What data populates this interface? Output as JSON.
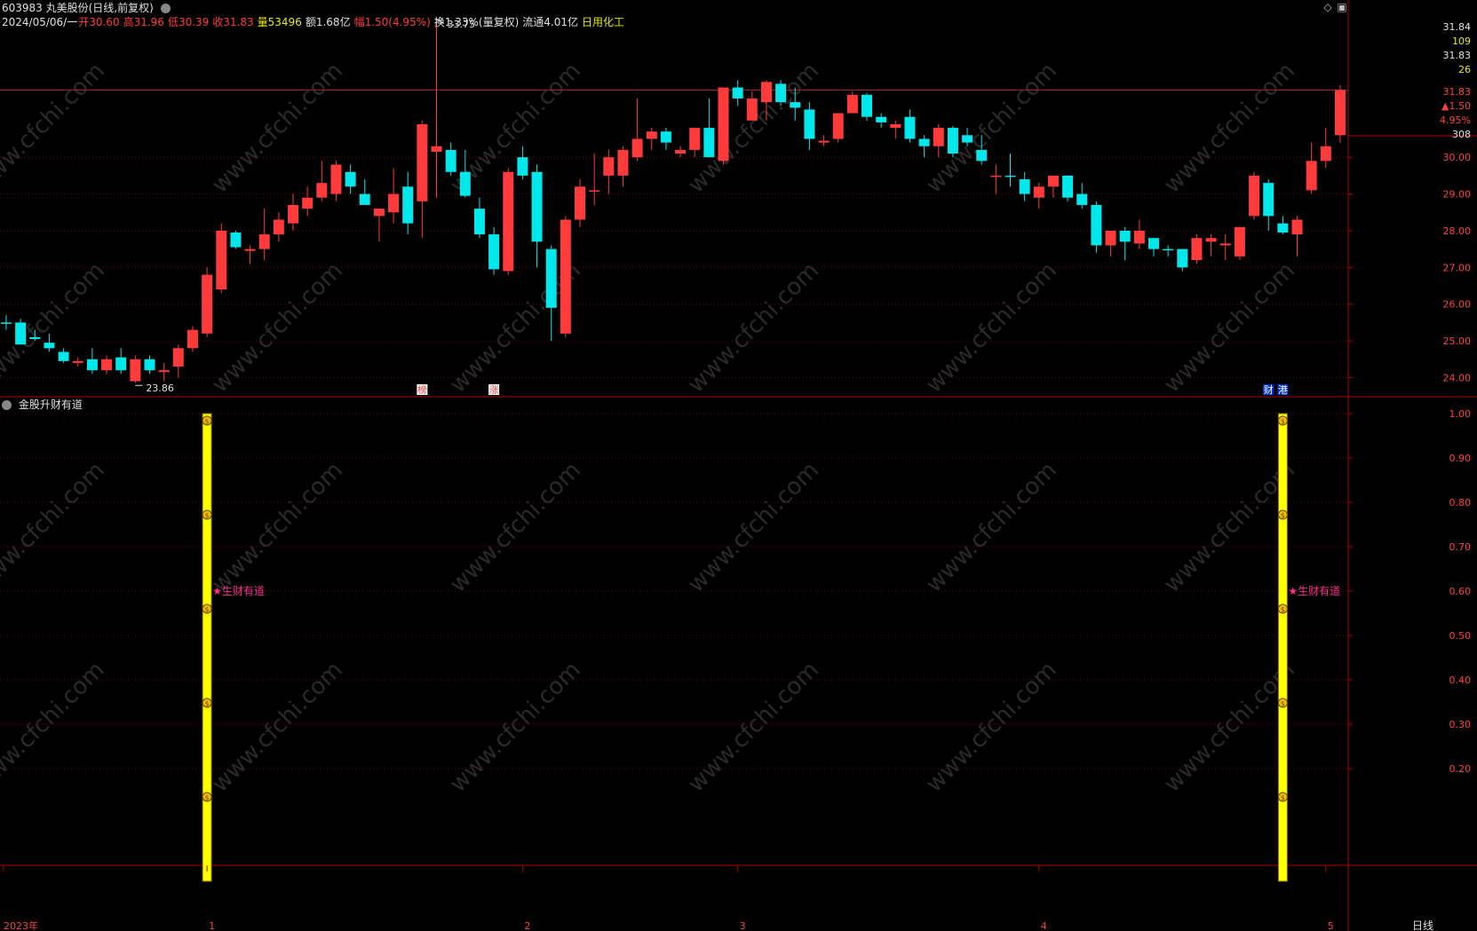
{
  "stock": {
    "code_name": "603983 丸美股份(日线,前复权)",
    "date": "2024/05/06/一",
    "open": "开30.60",
    "high": "高31.96",
    "low": "低30.39",
    "close": "收31.83",
    "volume": "量53496",
    "amount": "额1.68亿",
    "change": "幅1.50(4.95%)",
    "turnover": "换1.33%(量复权)",
    "float": "流通4.01亿",
    "industry": "日用化工"
  },
  "colors": {
    "up": "#ff3a3a",
    "down": "#00e8ec",
    "grid": "#7a0000",
    "axis": "#b00000",
    "signal_bar": "#ffff00",
    "signal_label": "#ff2d8f"
  },
  "price_axis": {
    "ticks": [
      "24.00",
      "25.00",
      "26.00",
      "27.00",
      "28.00",
      "29.00",
      "30.00"
    ],
    "top_labels": [
      "31.84",
      "109",
      "31.83",
      "26"
    ],
    "current_price": "31.83",
    "current_change": "▲1.50",
    "current_pct": "4.95%",
    "current_vol": "308",
    "max_label": "33.75",
    "min_label": "23.86"
  },
  "chart_data": {
    "type": "candlestick",
    "ylim": [
      23.6,
      32.3
    ],
    "candles": [
      {
        "o": 25.5,
        "h": 25.7,
        "l": 25.3,
        "c": 25.5,
        "up": 0
      },
      {
        "o": 25.5,
        "h": 25.6,
        "l": 24.9,
        "c": 24.9,
        "up": 0
      },
      {
        "o": 25.1,
        "h": 25.3,
        "l": 25.0,
        "c": 25.05,
        "up": 0
      },
      {
        "o": 24.95,
        "h": 25.2,
        "l": 24.7,
        "c": 24.8,
        "up": 0
      },
      {
        "o": 24.7,
        "h": 24.8,
        "l": 24.4,
        "c": 24.45,
        "up": 0
      },
      {
        "o": 24.4,
        "h": 24.55,
        "l": 24.3,
        "c": 24.45,
        "up": 1
      },
      {
        "o": 24.5,
        "h": 24.8,
        "l": 24.1,
        "c": 24.2,
        "up": 0
      },
      {
        "o": 24.2,
        "h": 24.6,
        "l": 24.1,
        "c": 24.5,
        "up": 1
      },
      {
        "o": 24.55,
        "h": 24.8,
        "l": 24.1,
        "c": 24.2,
        "up": 0
      },
      {
        "o": 23.9,
        "h": 24.6,
        "l": 23.86,
        "c": 24.5,
        "up": 1
      },
      {
        "o": 24.5,
        "h": 24.6,
        "l": 24.1,
        "c": 24.2,
        "up": 0
      },
      {
        "o": 24.15,
        "h": 24.4,
        "l": 23.9,
        "c": 24.2,
        "up": 1
      },
      {
        "o": 24.3,
        "h": 24.9,
        "l": 24.0,
        "c": 24.8,
        "up": 1
      },
      {
        "o": 24.8,
        "h": 25.4,
        "l": 24.7,
        "c": 25.3,
        "up": 1
      },
      {
        "o": 25.2,
        "h": 27.0,
        "l": 25.1,
        "c": 26.8,
        "up": 1
      },
      {
        "o": 26.4,
        "h": 28.2,
        "l": 26.3,
        "c": 28.0,
        "up": 1
      },
      {
        "o": 27.95,
        "h": 28.0,
        "l": 27.5,
        "c": 27.55,
        "up": 0
      },
      {
        "o": 27.45,
        "h": 27.6,
        "l": 27.1,
        "c": 27.5,
        "up": 1
      },
      {
        "o": 27.5,
        "h": 28.6,
        "l": 27.2,
        "c": 27.9,
        "up": 1
      },
      {
        "o": 27.9,
        "h": 28.5,
        "l": 27.7,
        "c": 28.3,
        "up": 1
      },
      {
        "o": 28.2,
        "h": 29.0,
        "l": 28.0,
        "c": 28.7,
        "up": 1
      },
      {
        "o": 28.6,
        "h": 29.2,
        "l": 28.4,
        "c": 28.9,
        "up": 1
      },
      {
        "o": 28.9,
        "h": 29.9,
        "l": 28.8,
        "c": 29.3,
        "up": 1
      },
      {
        "o": 29.0,
        "h": 29.9,
        "l": 28.8,
        "c": 29.8,
        "up": 1
      },
      {
        "o": 29.6,
        "h": 29.8,
        "l": 29.0,
        "c": 29.2,
        "up": 0
      },
      {
        "o": 29.0,
        "h": 29.4,
        "l": 28.7,
        "c": 28.7,
        "up": 0
      },
      {
        "o": 28.4,
        "h": 28.6,
        "l": 27.7,
        "c": 28.6,
        "up": 1
      },
      {
        "o": 28.5,
        "h": 29.7,
        "l": 28.2,
        "c": 29.0,
        "up": 1
      },
      {
        "o": 29.2,
        "h": 29.6,
        "l": 27.9,
        "c": 28.2,
        "up": 0
      },
      {
        "o": 28.8,
        "h": 31.0,
        "l": 27.8,
        "c": 30.9,
        "up": 1
      },
      {
        "o": 30.3,
        "h": 33.75,
        "l": 28.9,
        "c": 30.15,
        "up": 1
      },
      {
        "o": 30.2,
        "h": 30.4,
        "l": 29.5,
        "c": 29.6,
        "up": 0
      },
      {
        "o": 29.6,
        "h": 30.2,
        "l": 28.9,
        "c": 28.95,
        "up": 0
      },
      {
        "o": 28.6,
        "h": 28.9,
        "l": 27.8,
        "c": 27.9,
        "up": 0
      },
      {
        "o": 27.9,
        "h": 28.1,
        "l": 26.8,
        "c": 26.95,
        "up": 0
      },
      {
        "o": 26.9,
        "h": 29.7,
        "l": 26.8,
        "c": 29.6,
        "up": 1
      },
      {
        "o": 30.0,
        "h": 30.3,
        "l": 29.4,
        "c": 29.5,
        "up": 0
      },
      {
        "o": 29.6,
        "h": 29.8,
        "l": 27.0,
        "c": 27.7,
        "up": 0
      },
      {
        "o": 27.5,
        "h": 27.6,
        "l": 25.0,
        "c": 25.9,
        "up": 0
      },
      {
        "o": 25.2,
        "h": 28.4,
        "l": 25.1,
        "c": 28.3,
        "up": 1
      },
      {
        "o": 28.3,
        "h": 29.4,
        "l": 28.1,
        "c": 29.2,
        "up": 1
      },
      {
        "o": 29.1,
        "h": 30.1,
        "l": 28.7,
        "c": 29.1,
        "up": 1
      },
      {
        "o": 29.5,
        "h": 30.2,
        "l": 29.0,
        "c": 30.0,
        "up": 1
      },
      {
        "o": 29.5,
        "h": 30.3,
        "l": 29.2,
        "c": 30.2,
        "up": 1
      },
      {
        "o": 30.0,
        "h": 31.6,
        "l": 29.9,
        "c": 30.5,
        "up": 1
      },
      {
        "o": 30.5,
        "h": 30.8,
        "l": 30.2,
        "c": 30.7,
        "up": 1
      },
      {
        "o": 30.7,
        "h": 30.8,
        "l": 30.2,
        "c": 30.4,
        "up": 0
      },
      {
        "o": 30.1,
        "h": 30.3,
        "l": 30.0,
        "c": 30.2,
        "up": 1
      },
      {
        "o": 30.2,
        "h": 30.8,
        "l": 30.0,
        "c": 30.8,
        "up": 1
      },
      {
        "o": 30.8,
        "h": 31.6,
        "l": 30.0,
        "c": 30.0,
        "up": 0
      },
      {
        "o": 29.9,
        "h": 31.9,
        "l": 29.8,
        "c": 31.9,
        "up": 1
      },
      {
        "o": 31.9,
        "h": 32.1,
        "l": 31.4,
        "c": 31.6,
        "up": 0
      },
      {
        "o": 31.6,
        "h": 31.8,
        "l": 31.0,
        "c": 31.0,
        "up": 1
      },
      {
        "o": 31.5,
        "h": 32.1,
        "l": 31.0,
        "c": 32.05,
        "up": 1
      },
      {
        "o": 32.0,
        "h": 32.1,
        "l": 31.4,
        "c": 31.5,
        "up": 0
      },
      {
        "o": 31.5,
        "h": 31.9,
        "l": 31.0,
        "c": 31.35,
        "up": 0
      },
      {
        "o": 31.3,
        "h": 31.5,
        "l": 30.2,
        "c": 30.5,
        "up": 0
      },
      {
        "o": 30.4,
        "h": 30.6,
        "l": 30.3,
        "c": 30.45,
        "up": 1
      },
      {
        "o": 30.5,
        "h": 31.2,
        "l": 30.4,
        "c": 31.2,
        "up": 1
      },
      {
        "o": 31.2,
        "h": 31.8,
        "l": 31.2,
        "c": 31.7,
        "up": 1
      },
      {
        "o": 31.7,
        "h": 31.75,
        "l": 31.0,
        "c": 31.1,
        "up": 0
      },
      {
        "o": 31.1,
        "h": 31.2,
        "l": 30.8,
        "c": 30.95,
        "up": 0
      },
      {
        "o": 30.8,
        "h": 31.0,
        "l": 30.5,
        "c": 30.9,
        "up": 1
      },
      {
        "o": 31.1,
        "h": 31.3,
        "l": 30.4,
        "c": 30.5,
        "up": 0
      },
      {
        "o": 30.5,
        "h": 30.6,
        "l": 30.0,
        "c": 30.3,
        "up": 0
      },
      {
        "o": 30.3,
        "h": 30.9,
        "l": 30.0,
        "c": 30.8,
        "up": 1
      },
      {
        "o": 30.8,
        "h": 30.85,
        "l": 30.0,
        "c": 30.1,
        "up": 0
      },
      {
        "o": 30.6,
        "h": 30.8,
        "l": 30.3,
        "c": 30.4,
        "up": 0
      },
      {
        "o": 30.2,
        "h": 30.6,
        "l": 29.8,
        "c": 29.9,
        "up": 0
      },
      {
        "o": 29.5,
        "h": 29.8,
        "l": 29.0,
        "c": 29.5,
        "up": 1
      },
      {
        "o": 29.5,
        "h": 30.1,
        "l": 29.2,
        "c": 29.5,
        "up": 0
      },
      {
        "o": 29.4,
        "h": 29.6,
        "l": 28.8,
        "c": 29.0,
        "up": 0
      },
      {
        "o": 28.9,
        "h": 29.3,
        "l": 28.6,
        "c": 29.2,
        "up": 1
      },
      {
        "o": 29.2,
        "h": 29.5,
        "l": 28.9,
        "c": 29.5,
        "up": 1
      },
      {
        "o": 29.5,
        "h": 29.5,
        "l": 28.8,
        "c": 28.9,
        "up": 0
      },
      {
        "o": 29.0,
        "h": 29.3,
        "l": 28.6,
        "c": 28.7,
        "up": 0
      },
      {
        "o": 28.7,
        "h": 28.8,
        "l": 27.4,
        "c": 27.6,
        "up": 0
      },
      {
        "o": 27.6,
        "h": 28.0,
        "l": 27.3,
        "c": 28.0,
        "up": 1
      },
      {
        "o": 28.0,
        "h": 28.1,
        "l": 27.2,
        "c": 27.7,
        "up": 0
      },
      {
        "o": 27.65,
        "h": 28.3,
        "l": 27.5,
        "c": 28.0,
        "up": 1
      },
      {
        "o": 27.8,
        "h": 27.8,
        "l": 27.3,
        "c": 27.5,
        "up": 0
      },
      {
        "o": 27.5,
        "h": 27.6,
        "l": 27.3,
        "c": 27.5,
        "up": 0
      },
      {
        "o": 27.5,
        "h": 27.5,
        "l": 26.9,
        "c": 27.0,
        "up": 0
      },
      {
        "o": 27.2,
        "h": 27.9,
        "l": 27.1,
        "c": 27.8,
        "up": 1
      },
      {
        "o": 27.8,
        "h": 27.9,
        "l": 27.3,
        "c": 27.7,
        "up": 1
      },
      {
        "o": 27.6,
        "h": 27.9,
        "l": 27.2,
        "c": 27.65,
        "up": 1
      },
      {
        "o": 27.3,
        "h": 28.1,
        "l": 27.2,
        "c": 28.1,
        "up": 1
      },
      {
        "o": 28.4,
        "h": 29.6,
        "l": 28.3,
        "c": 29.5,
        "up": 1
      },
      {
        "o": 29.3,
        "h": 29.4,
        "l": 28.0,
        "c": 28.4,
        "up": 0
      },
      {
        "o": 28.2,
        "h": 28.4,
        "l": 27.9,
        "c": 27.95,
        "up": 0
      },
      {
        "o": 27.9,
        "h": 28.4,
        "l": 27.3,
        "c": 28.3,
        "up": 1
      },
      {
        "o": 29.1,
        "h": 30.4,
        "l": 29.0,
        "c": 29.9,
        "up": 1
      },
      {
        "o": 29.9,
        "h": 30.8,
        "l": 29.7,
        "c": 30.3,
        "up": 1
      },
      {
        "o": 30.6,
        "h": 31.96,
        "l": 30.39,
        "c": 31.83,
        "up": 1
      }
    ],
    "markers": [
      {
        "i": 29,
        "text": "榜",
        "color": "#ff3a3a",
        "bg": "#ffffff"
      },
      {
        "i": 34,
        "text": "涨",
        "color": "#ff3a3a",
        "bg": "#ffffff"
      },
      {
        "i": 88,
        "text": "财",
        "color": "#ffffff",
        "bg": "#0033cc"
      },
      {
        "i": 89,
        "text": "港",
        "color": "#ffffff",
        "bg": "#0033cc"
      }
    ]
  },
  "indicator": {
    "title": "金股升财有道",
    "label": "★生财有道",
    "signal_index": [
      14,
      89
    ],
    "signal_value": 1.0,
    "ylim": [
      0,
      1.0
    ],
    "ticks": [
      "1.00",
      "0.90",
      "0.80",
      "0.70",
      "0.60",
      "0.50",
      "0.40",
      "0.30",
      "0.20"
    ]
  },
  "time_axis": {
    "labels": [
      {
        "i": 0,
        "text": "2023年"
      },
      {
        "i": 14,
        "text": "1"
      },
      {
        "i": 36,
        "text": "2"
      },
      {
        "i": 51,
        "text": "3"
      },
      {
        "i": 72,
        "text": "4"
      },
      {
        "i": 92,
        "text": "5"
      }
    ],
    "period": "日线"
  },
  "watermark": "www.cfchi.com"
}
